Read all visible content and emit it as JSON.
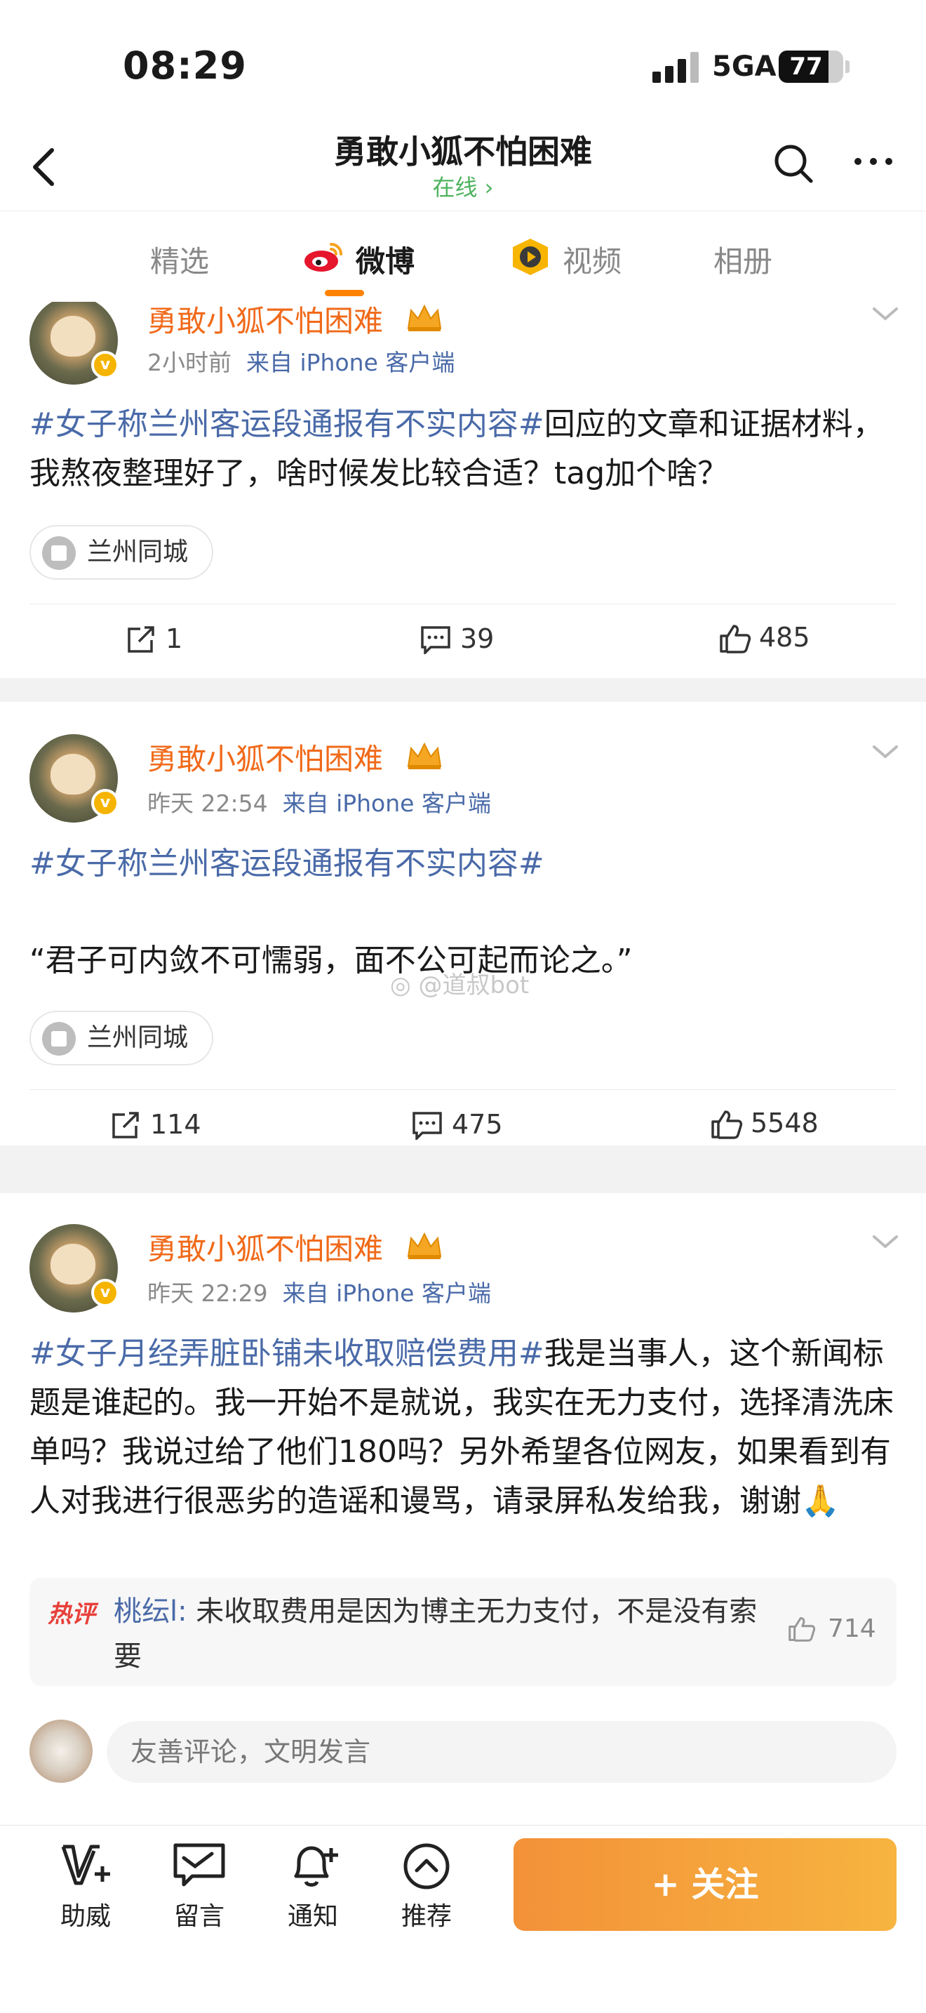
{
  "status_bar": {
    "time": "08:29",
    "network": "5GA",
    "battery": "77",
    "battery_level": 0.77
  },
  "nav": {
    "title": "勇敢小狐不怕困难",
    "subtitle": "在线 ›"
  },
  "tabs": [
    {
      "label": "精选",
      "active": false
    },
    {
      "label": "微博",
      "active": true
    },
    {
      "label": "视频",
      "active": false
    },
    {
      "label": "相册",
      "active": false
    }
  ],
  "posts": [
    {
      "author": "勇敢小狐不怕困难",
      "time": "2小时前",
      "source": "来自 iPhone 客户端",
      "hashtag": "#女子称兰州客运段通报有不实内容#",
      "text": "回应的文章和证据材料，我熬夜整理好了，啥时候发比较合适？tag加个啥？",
      "location": "兰州同城",
      "reposts": "1",
      "comments": "39",
      "likes": "485"
    },
    {
      "author": "勇敢小狐不怕困难",
      "time": "昨天 22:54",
      "source": "来自 iPhone 客户端",
      "hashtag": "#女子称兰州客运段通报有不实内容#",
      "quote": "“君子可内敛不可懦弱，面不公可起而论之。”",
      "location": "兰州同城",
      "reposts": "114",
      "comments": "475",
      "likes": "5548"
    },
    {
      "author": "勇敢小狐不怕困难",
      "time": "昨天 22:29",
      "source": "来自 iPhone 客户端",
      "hashtag": "#女子月经弄脏卧铺未收取赔偿费用#",
      "text": "我是当事人，这个新闻标题是谁起的。我一开始不是就说，我实在无力支付，选择清洗床单吗？我说过给了他们180吗？另外希望各位网友，如果看到有人对我进行很恶劣的造谣和谩骂，请录屏私发给我，谢谢🙏",
      "hot_comment": {
        "tag": "热评",
        "user": "桃纭l:",
        "text": " 未收取费用是因为博主无力支付，不是没有索要",
        "likes": "714"
      },
      "comment_placeholder": "友善评论，文明发言"
    }
  ],
  "watermark": "@道叔bot",
  "toolbar": {
    "items": [
      {
        "label": "助威",
        "icon": "cheer-icon"
      },
      {
        "label": "留言",
        "icon": "message-icon"
      },
      {
        "label": "通知",
        "icon": "bell-plus-icon"
      },
      {
        "label": "推荐",
        "icon": "recommend-icon"
      }
    ],
    "follow_label": "+ 关注"
  },
  "colors": {
    "accent": "#ff8200",
    "author": "#f06a1a",
    "link": "#4a6aa8",
    "online": "#4db35e",
    "follow_start": "#f39139",
    "follow_end": "#f7b43f"
  }
}
